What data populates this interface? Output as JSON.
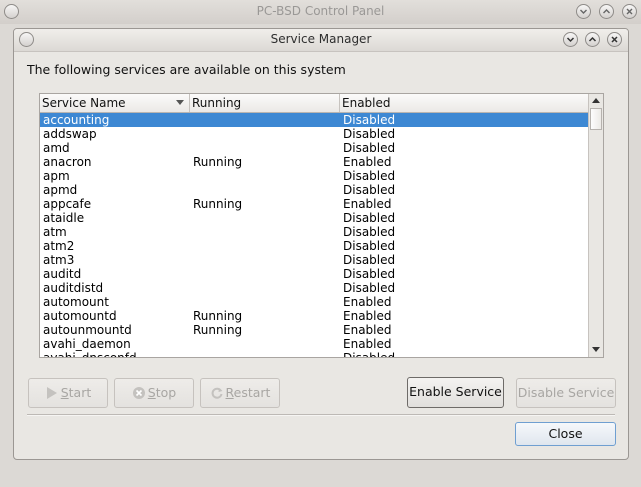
{
  "outer_window": {
    "title": "PC-BSD Control Panel"
  },
  "dialog": {
    "title": "Service Manager",
    "heading": "The following services are available on this system"
  },
  "table": {
    "columns": [
      "Service Name",
      "Running",
      "Enabled"
    ],
    "rows": [
      {
        "name": "accounting",
        "running": "",
        "enabled": "Disabled",
        "selected": true
      },
      {
        "name": "addswap",
        "running": "",
        "enabled": "Disabled"
      },
      {
        "name": "amd",
        "running": "",
        "enabled": "Disabled"
      },
      {
        "name": "anacron",
        "running": "Running",
        "enabled": "Enabled"
      },
      {
        "name": "apm",
        "running": "",
        "enabled": "Disabled"
      },
      {
        "name": "apmd",
        "running": "",
        "enabled": "Disabled"
      },
      {
        "name": "appcafe",
        "running": "Running",
        "enabled": "Enabled"
      },
      {
        "name": "ataidle",
        "running": "",
        "enabled": "Disabled"
      },
      {
        "name": "atm",
        "running": "",
        "enabled": "Disabled"
      },
      {
        "name": "atm2",
        "running": "",
        "enabled": "Disabled"
      },
      {
        "name": "atm3",
        "running": "",
        "enabled": "Disabled"
      },
      {
        "name": "auditd",
        "running": "",
        "enabled": "Disabled"
      },
      {
        "name": "auditdistd",
        "running": "",
        "enabled": "Disabled"
      },
      {
        "name": "automount",
        "running": "",
        "enabled": "Enabled"
      },
      {
        "name": "automountd",
        "running": "Running",
        "enabled": "Enabled"
      },
      {
        "name": "autounmountd",
        "running": "Running",
        "enabled": "Enabled"
      },
      {
        "name": "avahi_daemon",
        "running": "",
        "enabled": "Enabled"
      },
      {
        "name": "avahi_dnsconfd",
        "running": "",
        "enabled": "Disabled"
      }
    ]
  },
  "buttons": {
    "start": "Start",
    "stop": "Stop",
    "restart": "Restart",
    "enable": "Enable Service",
    "disable": "Disable Service",
    "close": "Close"
  },
  "colors": {
    "selection": "#3d88d3"
  }
}
